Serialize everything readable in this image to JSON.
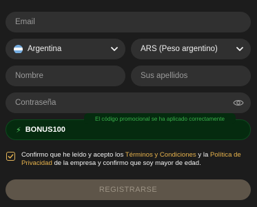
{
  "form": {
    "email_placeholder": "Email",
    "country_value": "Argentina",
    "currency_value": "ARS (Peso argentino)",
    "first_name_placeholder": "Nombre",
    "last_name_placeholder": "Sus apellidos",
    "password_placeholder": "Contraseña",
    "promo_code_value": "BONUS100",
    "promo_success_message": "El código promocional se ha aplicado correctamente",
    "terms_part1": "Confirmo que he leído y acepto los ",
    "terms_link1": "Términos y Condiciones",
    "terms_part2": " y la ",
    "terms_link2": "Política de Privacidad",
    "terms_part3": " de la empresa y confirmo que soy mayor de edad.",
    "terms_checked": true,
    "register_label": "REGISTRARSE"
  },
  "colors": {
    "background": "#1c1c1c",
    "field": "#303030",
    "accent": "#e6b24c",
    "promo_success": "#38b14a",
    "button_disabled": "#5e5549"
  },
  "icons": {
    "country_flag": "argentina-flag-icon",
    "dropdown": "chevron-down-icon",
    "password_toggle": "eye-icon",
    "promo": "lightning-icon",
    "checkbox": "checkmark-icon"
  }
}
